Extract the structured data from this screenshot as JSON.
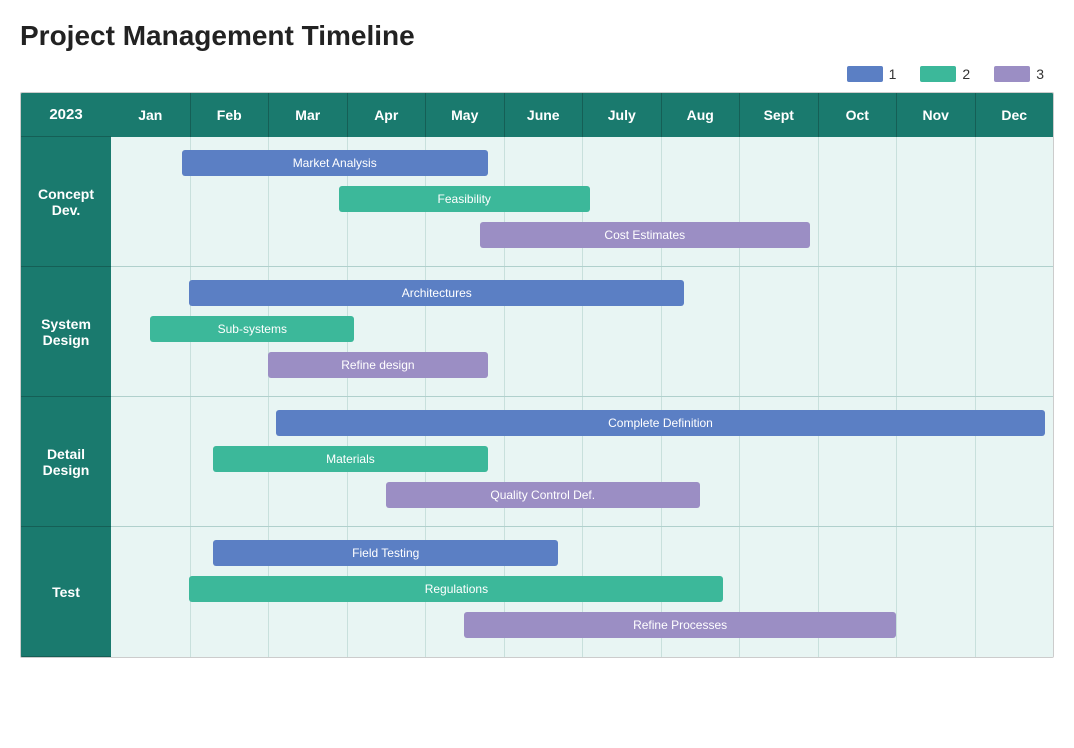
{
  "title": "Project Management Timeline",
  "legend": [
    {
      "id": 1,
      "label": "1",
      "color": "#5b7fc4"
    },
    {
      "id": 2,
      "label": "2",
      "color": "#3cb89a"
    },
    {
      "id": 3,
      "label": "3",
      "color": "#9b8ec4"
    }
  ],
  "year": "2023",
  "months": [
    "Jan",
    "Feb",
    "Mar",
    "Apr",
    "May",
    "June",
    "July",
    "Aug",
    "Sept",
    "Oct",
    "Nov",
    "Dec"
  ],
  "sections": [
    {
      "id": "concept-dev",
      "label": "Concept Dev.",
      "height": 130,
      "bars": [
        {
          "label": "Market Analysis",
          "type": "blue",
          "start": 0.9,
          "span": 3.9
        },
        {
          "label": "Feasibility",
          "type": "teal",
          "start": 2.9,
          "span": 3.2
        },
        {
          "label": "Cost Estimates",
          "type": "purple",
          "start": 4.7,
          "span": 4.2
        }
      ]
    },
    {
      "id": "system-design",
      "label": "System Design",
      "height": 130,
      "bars": [
        {
          "label": "Architectures",
          "type": "blue",
          "start": 1.0,
          "span": 6.3
        },
        {
          "label": "Sub-systems",
          "type": "teal",
          "start": 0.5,
          "span": 2.6
        },
        {
          "label": "Refine design",
          "type": "purple",
          "start": 2.0,
          "span": 2.8
        }
      ]
    },
    {
      "id": "detail-design",
      "label": "Detail Design",
      "height": 130,
      "bars": [
        {
          "label": "Complete Definition",
          "type": "blue",
          "start": 2.1,
          "span": 9.8
        },
        {
          "label": "Materials",
          "type": "teal",
          "start": 1.3,
          "span": 3.5
        },
        {
          "label": "Quality Control Def.",
          "type": "purple",
          "start": 3.5,
          "span": 4.0
        }
      ]
    },
    {
      "id": "test",
      "label": "Test",
      "height": 130,
      "bars": [
        {
          "label": "Field Testing",
          "type": "blue",
          "start": 1.3,
          "span": 4.4
        },
        {
          "label": "Regulations",
          "type": "teal",
          "start": 1.0,
          "span": 6.8
        },
        {
          "label": "Refine Processes",
          "type": "purple",
          "start": 4.5,
          "span": 5.5
        }
      ]
    }
  ]
}
